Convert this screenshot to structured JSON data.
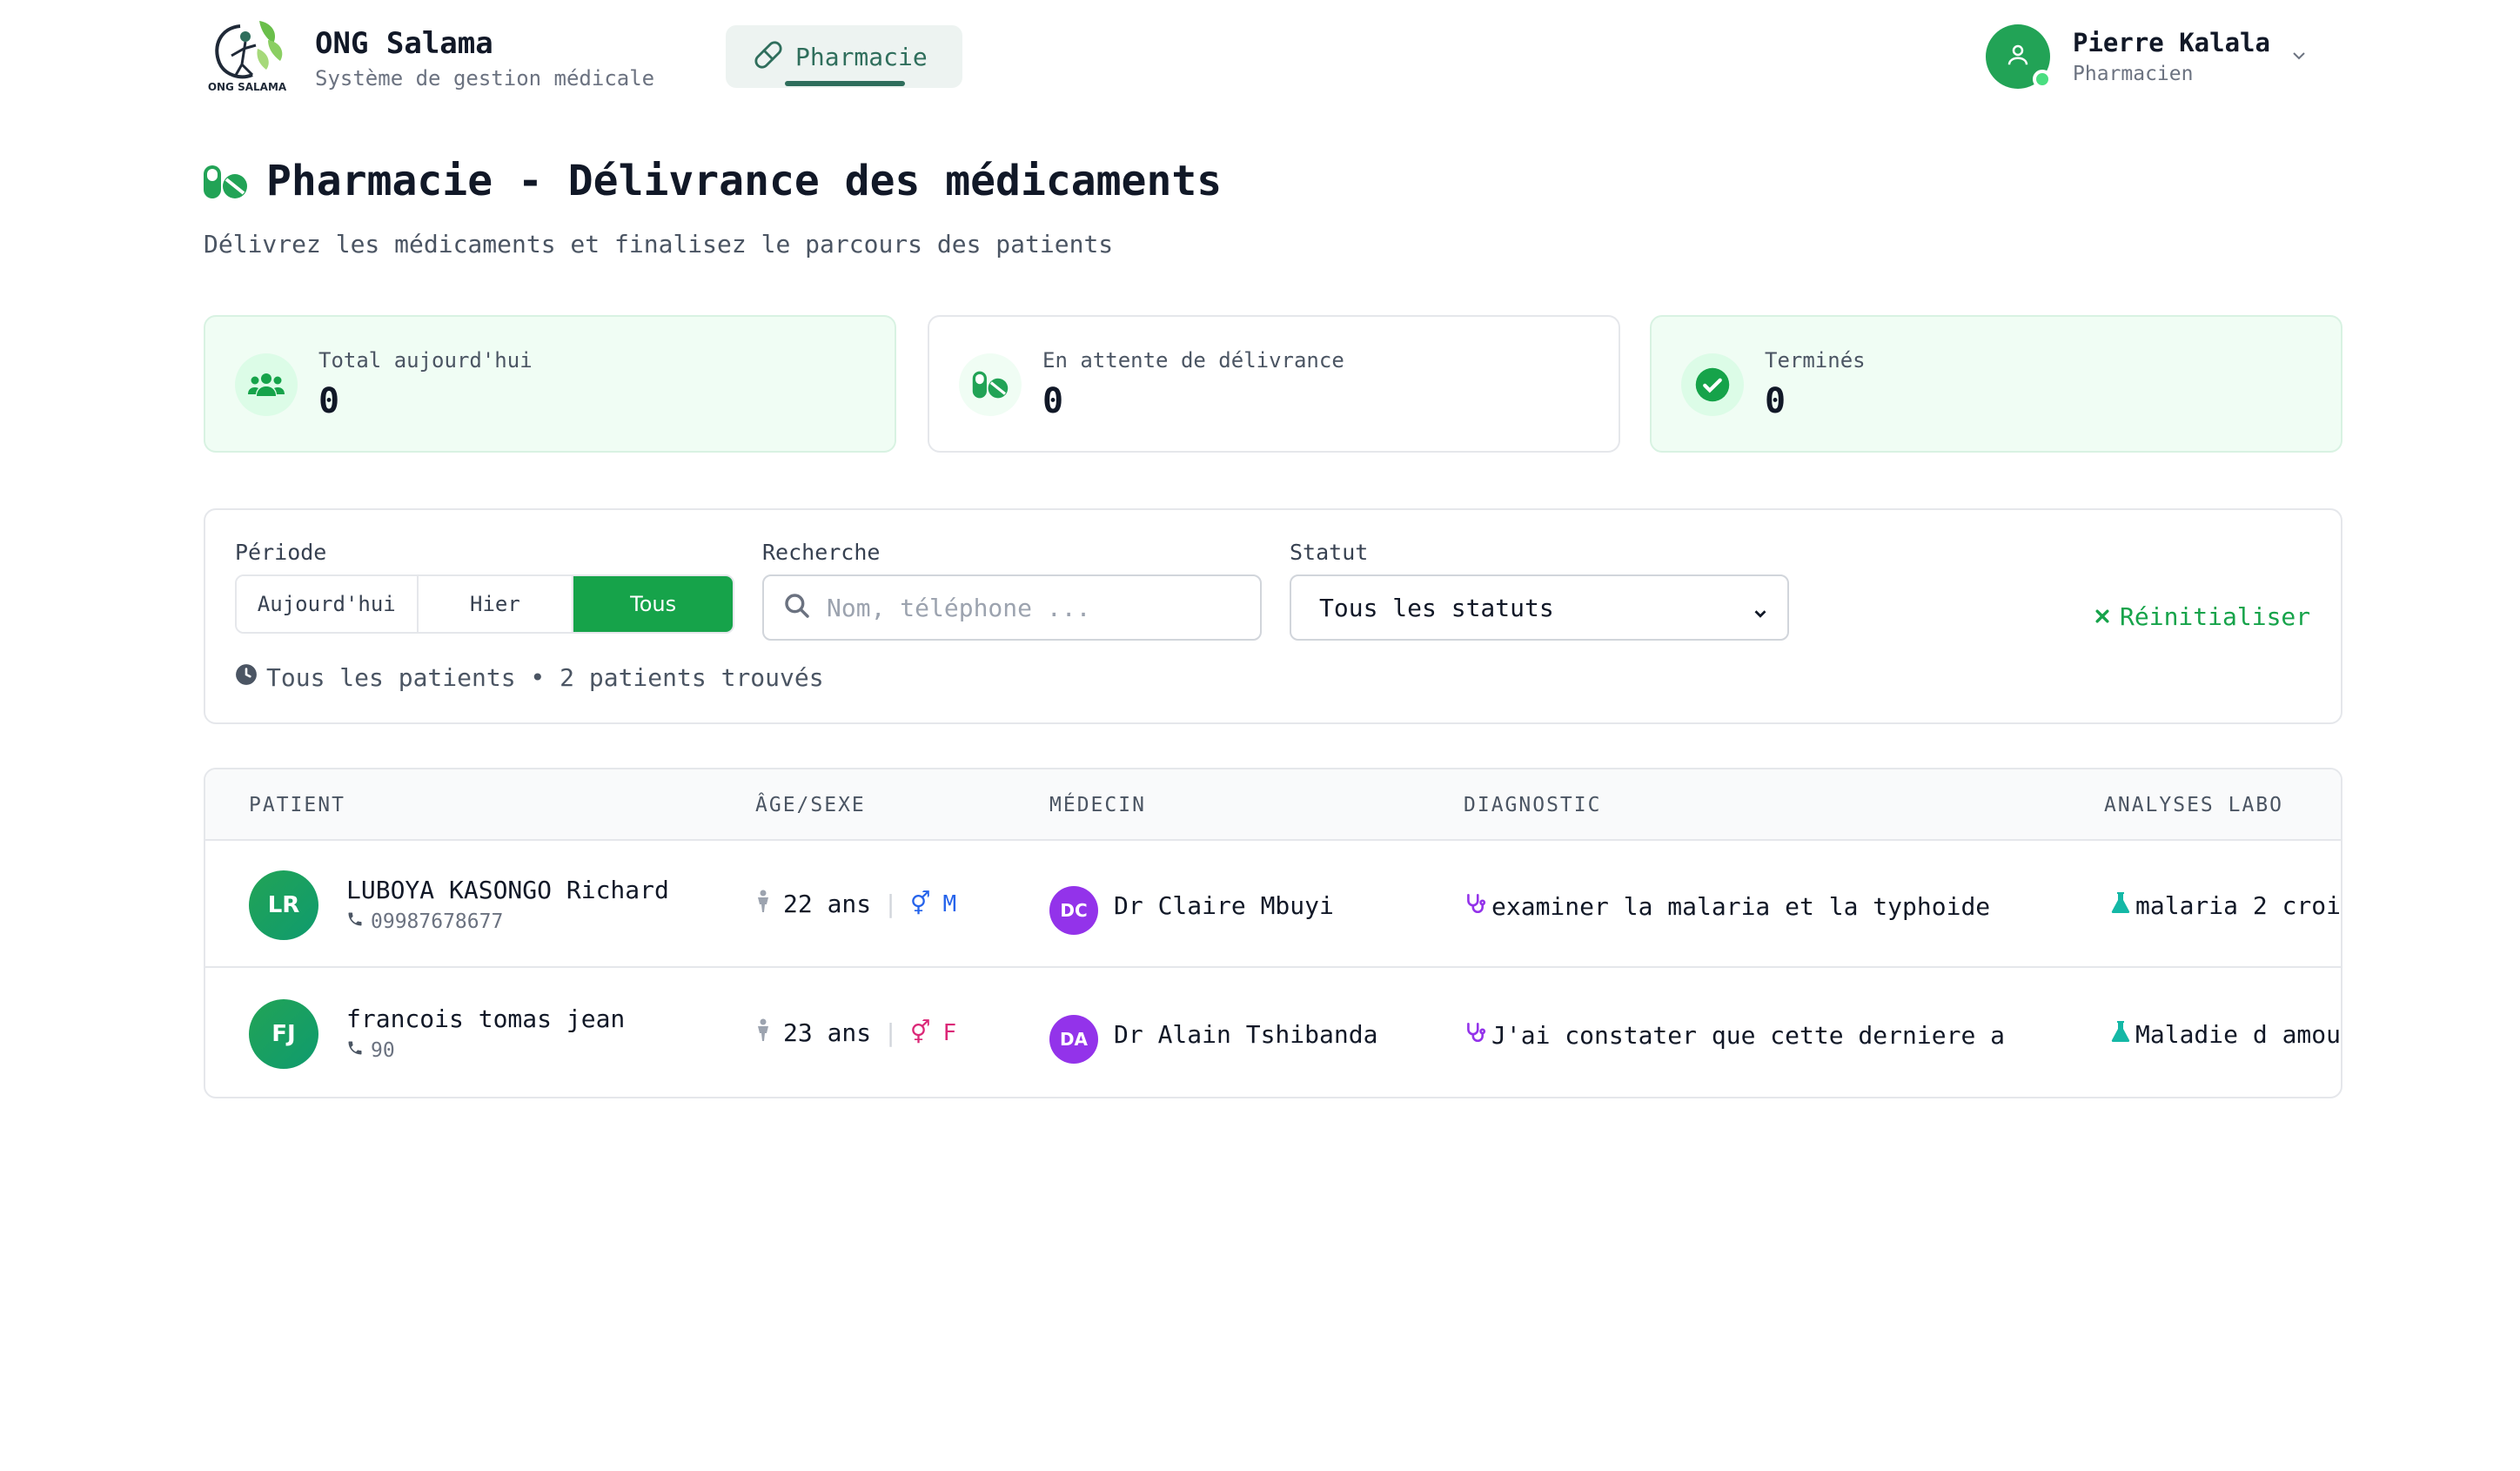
{
  "brand": {
    "logo_text": "ONG SALAMA",
    "title": "ONG Salama",
    "subtitle": "Système de gestion médicale"
  },
  "nav": {
    "active_tab": "Pharmacie",
    "icon": "pill-icon"
  },
  "user": {
    "name": "Pierre Kalala",
    "role": "Pharmacien",
    "status_color": "#4ade80"
  },
  "page": {
    "title": "Pharmacie - Délivrance des médicaments",
    "subtitle": "Délivrez les médicaments et finalisez le parcours des patients"
  },
  "stats": [
    {
      "label": "Total aujourd'hui",
      "value": "0",
      "icon": "users-icon"
    },
    {
      "label": "En attente de délivrance",
      "value": "0",
      "icon": "pills-icon"
    },
    {
      "label": "Terminés",
      "value": "0",
      "icon": "check-circle-icon"
    }
  ],
  "filters": {
    "period_label": "Période",
    "periods": [
      "Aujourd'hui",
      "Hier",
      "Tous"
    ],
    "active_period": "Tous",
    "search_label": "Recherche",
    "search_placeholder": "Nom, téléphone ...",
    "search_value": "",
    "status_label": "Statut",
    "status_selected": "Tous les statuts",
    "reset_label": "Réinitialiser",
    "summary": "Tous les patients • 2 patients trouvés"
  },
  "table": {
    "columns": [
      "PATIENT",
      "ÂGE/SEXE",
      "MÉDECIN",
      "DIAGNOSTIC",
      "ANALYSES LABO"
    ],
    "rows": [
      {
        "initials": "LR",
        "name": "LUBOYA KASONGO Richard",
        "phone": "09987678677",
        "age": "22 ans",
        "sex": "M",
        "doctor_initials": "DC",
        "doctor": "Dr Claire Mbuyi",
        "diagnostic": "examiner la malaria et la typhoide",
        "labo": "malaria 2 croi"
      },
      {
        "initials": "FJ",
        "name": "francois tomas jean",
        "phone": "90",
        "age": "23 ans",
        "sex": "F",
        "doctor_initials": "DA",
        "doctor": "Dr Alain Tshibanda",
        "diagnostic": "J'ai constater que cette derniere a…",
        "labo": "Maladie d amou"
      }
    ]
  },
  "colors": {
    "accent": "#16a34a",
    "nav_accent": "#2f6e5c",
    "doctor": "#9333ea",
    "male": "#2563eb",
    "female": "#db2777"
  }
}
